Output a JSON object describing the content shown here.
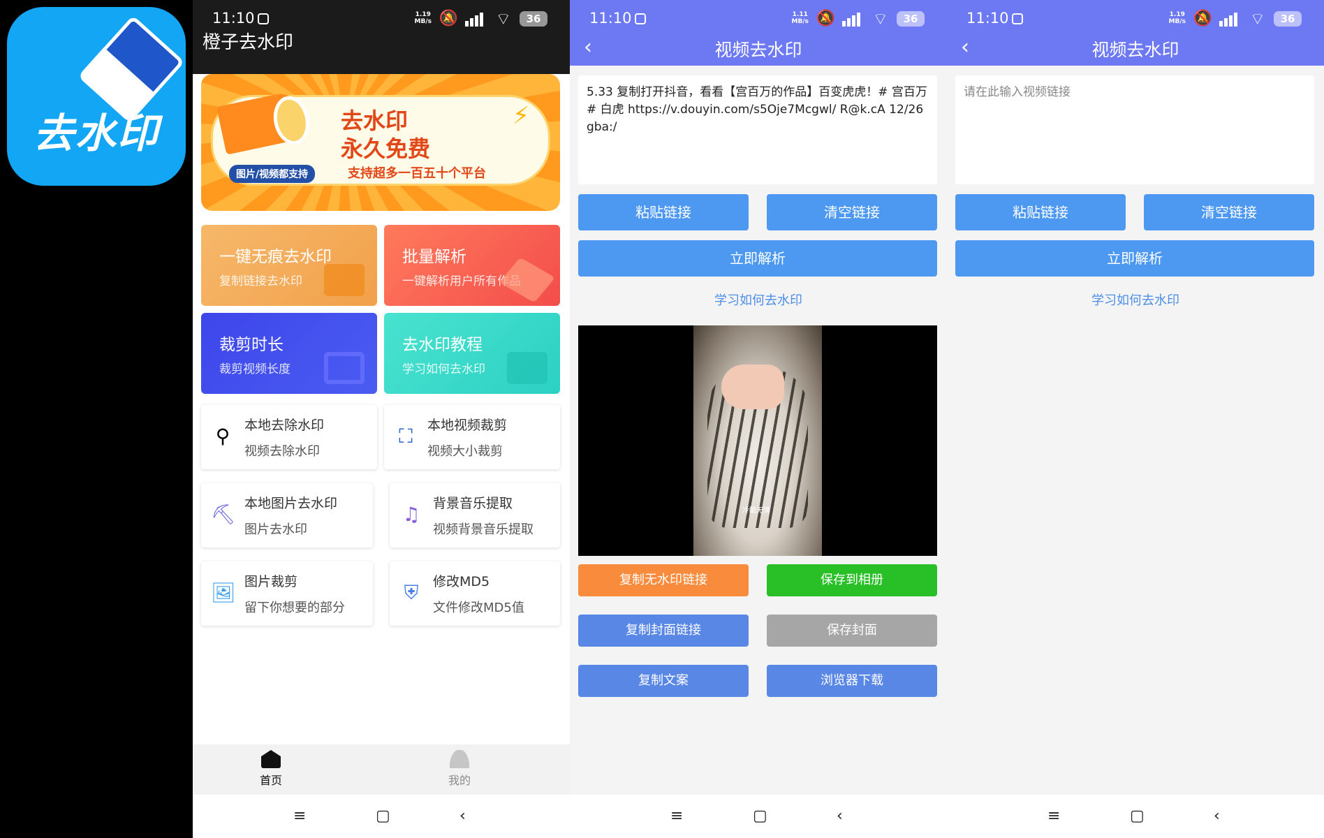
{
  "app_icon": {
    "label": "去水印",
    "color": "#13a6f5"
  },
  "status": {
    "time": "11:10",
    "battery": "36",
    "net_p1": "1.19\nMB/s",
    "net_p2": "1.11\nMB/s",
    "net_p3": "1.19\nMB/s"
  },
  "home": {
    "title": "橙子去水印",
    "banner": {
      "line1": "去水印",
      "line2": "永久免费",
      "tag": "图片/视频都支持",
      "subtitle": "支持超多一百五十个平台"
    },
    "cards": [
      {
        "title": "一键无痕去水印",
        "subtitle": "复制链接去水印"
      },
      {
        "title": "批量解析",
        "subtitle": "一键解析用户所有作品"
      },
      {
        "title": "裁剪时长",
        "subtitle": "裁剪视频长度"
      },
      {
        "title": "去水印教程",
        "subtitle": "学习如何去水印"
      }
    ],
    "tools": [
      {
        "title": "本地去除水印",
        "subtitle": "视频去除水印",
        "icon": "stamp-icon"
      },
      {
        "title": "本地视频裁剪",
        "subtitle": "视频大小裁剪",
        "icon": "crop-icon"
      },
      {
        "title": "本地图片去水印",
        "subtitle": "图片去水印",
        "icon": "paint-roller-icon"
      },
      {
        "title": "背景音乐提取",
        "subtitle": "视频背景音乐提取",
        "icon": "music-note-icon"
      },
      {
        "title": "图片裁剪",
        "subtitle": "留下你想要的部分",
        "icon": "image-icon"
      },
      {
        "title": "修改MD5",
        "subtitle": "文件修改MD5值",
        "icon": "shield-icon"
      }
    ],
    "tabs": [
      {
        "label": "首页",
        "icon": "home-icon"
      },
      {
        "label": "我的",
        "icon": "user-icon"
      }
    ]
  },
  "nav": {
    "menu": "≡",
    "home": "▢",
    "back": "‹"
  },
  "detail": {
    "title": "视频去水印",
    "back": "‹",
    "link_text": "5.33 复制打开抖音，看看【宫百万的作品】百变虎虎！# 宫百万 # 白虎  https://v.douyin.com/s5Oje7Mcgwl/ R@k.cA 12/26 gba:/",
    "placeholder": "请在此输入视频链接",
    "paste": "粘贴链接",
    "clear": "清空链接",
    "parse": "立即解析",
    "learn": "学习如何去水印",
    "video_watermark": "冷酷无情",
    "copy_link": "复制无水印链接",
    "save_album": "保存到相册",
    "copy_cover": "复制封面链接",
    "save_cover": "保存封面",
    "copy_text": "复制文案",
    "browser_dl": "浏览器下载"
  }
}
